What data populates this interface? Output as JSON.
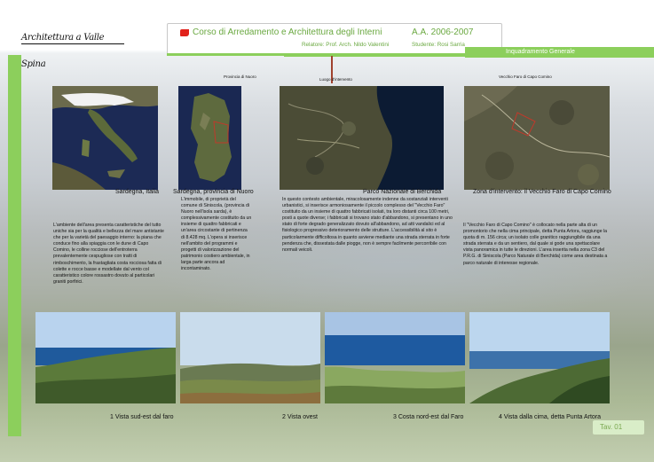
{
  "header": {
    "logo_text": "Architettura a Valle Spina",
    "title": "Corso di Arredamento e Architettura degli Interni",
    "academic_year": "A.A. 2006-2007",
    "relatore": "Relatore: Prof. Arch. Nildo Valentini",
    "studente": "Studente: Rosi Sarria",
    "section": "Inquadramento Generale"
  },
  "map_tags": {
    "nuoro": "Provincia di Nuoro",
    "intervento": "Luogo d'intervento",
    "faro": "Vecchio Faro di Capo Comino"
  },
  "maps": [
    {
      "caption": "Sardegna, Italia"
    },
    {
      "caption": "Sardegna, provincia di Nuoro"
    },
    {
      "caption": "Parco Nazionale di Berchida"
    },
    {
      "caption": "Zona d'intervento: il Vecchio Faro di Capo Comino"
    }
  ],
  "texts": [
    "L'ambiente dell'area presenta caratteristiche del tutto uniche sia per la qualità e bellezza del mare antistante che per la varietà del paesaggio interno: la piana che conduce fino alla spiaggia con le dune di Capo Comino, le colline rocciose dell'entroterra prevalentemente cespugliose con tratti di rimboschimento, la frastagliata costa rocciosa fatta di colette e rocce basse e modellate dal vento col caratteristico colore rossastro dovuto al particolari graniti porfirici.",
    "L'immobile, di proprietà del comune di Siniscola, (provincia di Nuoro nell'isola sarda), è complessivamente costituito da un insieme di quattro fabbricati e un'area circostante di pertinenza di 8.428 mq. L'opera si inserisce nell'ambito del programmi e progetti di valorizzazione del patrimonio costiero ambientale, in larga parte ancora ad incontaminato.",
    "In questo contesto ambientale, miracolosamente indenne da sostanziali interventi urbanistici, si inserisce armoniosamente il piccolo complesso del \"Vecchio Faro\" costituito da un insieme di quattro fabbricati isolati, tra loro distanti circa 100 metri, posti a quote diverse; i fabbricati si trovano stato d'abbandono, si presentano in uno stato di forte degrado generalizzato dovuto all'abbandono, ad atti vandalici ed al fisiologico progressivo deterioramento delle strutture. L'accessibilità al sito è particolarmente difficoltosa in quanto avviene mediante una strada sterrata in forte pendenza che, dissestata dalle piogge, non è sempre facilmente percorribile con normali veicoli.",
    "Il \"Vecchio Faro di Capo Comino\" è collocato nella parte alta di un promontorio che nella cima principale, detta Punta Artora, raggiunge la quota di m. 156 circa; un isolato colle granitico raggiungibile da una strada sterrata e da un sentiero, dal quale si gode una spettacolare vista panoramica in tutte le direzioni. L'area inserita nella zona C3 del P.R.G. di Siniscola (Parco Naturale di Berchida) come area destinata a parco naturale di interesse regionale."
  ],
  "photos": [
    {
      "caption": "1  Vista sud-est dal faro"
    },
    {
      "caption": "2  Vista ovest"
    },
    {
      "caption": "3  Costa nord-est dal Faro"
    },
    {
      "caption": "4  Vista dalla cima, detta Punta Artora"
    }
  ],
  "footer": {
    "tav_label": "Tav.  01"
  },
  "colors": {
    "accent_green": "#8ccf5c",
    "title_green": "#6aa840",
    "flag_red": "#e1221b"
  }
}
